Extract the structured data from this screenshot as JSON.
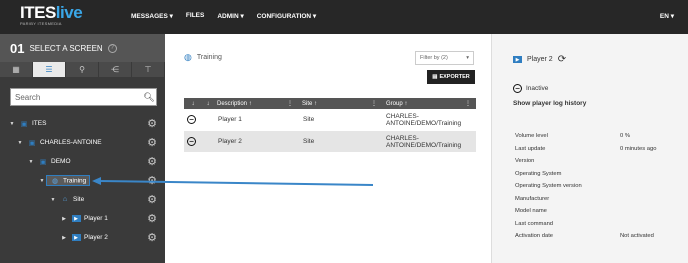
{
  "topbar": {
    "logo_main": "ITES",
    "logo_accent": "live",
    "logo_sub": "PAR/BY ITESMEDIA",
    "nav": [
      "MESSAGES ▾",
      "FILES",
      "ADMIN ▾",
      "CONFIGURATION ▾"
    ],
    "lang": "EN ▾"
  },
  "sidebar": {
    "step_number": "01",
    "step_label": "SELECT A SCREEN",
    "help": "?",
    "tabs": [
      "grid-icon",
      "tree-icon",
      "user-icon",
      "share-icon",
      "network-icon"
    ],
    "search_placeholder": "Search",
    "tree": [
      {
        "label": "ITES",
        "level": 0
      },
      {
        "label": "CHARLES-ANTOINE",
        "level": 1
      },
      {
        "label": "DEMO",
        "level": 2
      },
      {
        "label": "Training",
        "level": 3
      },
      {
        "label": "Site",
        "level": 4
      },
      {
        "label": "Player 1",
        "level": 5
      },
      {
        "label": "Player 2",
        "level": 5
      }
    ]
  },
  "main": {
    "breadcrumb": "Training",
    "filter_label": "Filter by (2)",
    "exporter_label": "EXPORTER",
    "columns": [
      "Description",
      "Site",
      "Group"
    ],
    "rows": [
      {
        "description": "Player 1",
        "site": "Site",
        "group": "CHARLES-ANTOINE/DEMO/Training"
      },
      {
        "description": "Player 2",
        "site": "Site",
        "group": "CHARLES-ANTOINE/DEMO/Training"
      }
    ]
  },
  "details": {
    "title": "Player 2",
    "status": "Inactive",
    "log_link": "Show player log history",
    "properties": [
      {
        "key": "Volume level",
        "value": "0 %"
      },
      {
        "key": "Last update",
        "value": "0 minutes ago"
      },
      {
        "key": "Version",
        "value": ""
      },
      {
        "key": "Operating System",
        "value": ""
      },
      {
        "key": "Operating System version",
        "value": ""
      },
      {
        "key": "Manufacturer",
        "value": ""
      },
      {
        "key": "Model name",
        "value": ""
      },
      {
        "key": "Last command",
        "value": ""
      },
      {
        "key": "Activation date",
        "value": "Not activated"
      }
    ]
  },
  "colors": {
    "accent": "#2f7ec1",
    "topbar": "#272727",
    "sidebar": "#3a3a3a"
  }
}
